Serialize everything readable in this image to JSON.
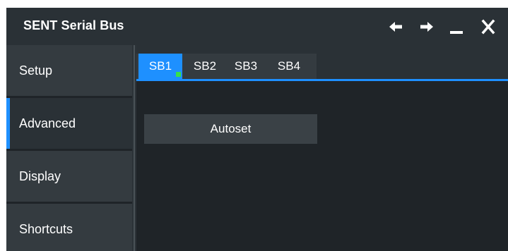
{
  "window": {
    "title": "SENT Serial Bus",
    "controls": [
      {
        "name": "back-arrow-icon",
        "glyph": "←"
      },
      {
        "name": "forward-arrow-icon",
        "glyph": "→"
      },
      {
        "name": "minimize-icon",
        "glyph": "_"
      },
      {
        "name": "close-icon",
        "glyph": "✕"
      }
    ]
  },
  "sidebar": {
    "items": [
      {
        "label": "Setup",
        "active": false
      },
      {
        "label": "Advanced",
        "active": true
      },
      {
        "label": "Display",
        "active": false
      },
      {
        "label": "Shortcuts",
        "active": false
      }
    ]
  },
  "tabs": [
    {
      "label": "SB1",
      "active": true,
      "status": "enabled"
    },
    {
      "label": "SB2",
      "active": false
    },
    {
      "label": "SB3",
      "active": false
    },
    {
      "label": "SB4",
      "active": false
    }
  ],
  "main": {
    "autoset_label": "Autoset"
  },
  "colors": {
    "accent": "#1e90ff",
    "status_dot": "#36e04a",
    "background": "#1f2428",
    "titlebar": "#2a3136"
  }
}
